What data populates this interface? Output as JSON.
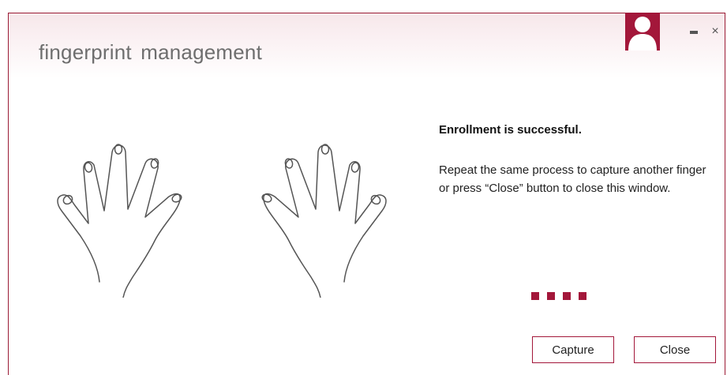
{
  "window": {
    "title": "fingerprint  management",
    "controls": {
      "minimize_glyph": "–",
      "close_glyph": "×"
    }
  },
  "status": {
    "heading": "Enrollment is successful.",
    "message": "Repeat the same process to capture another finger or press “Close” button to close this window."
  },
  "progress": {
    "steps": 4
  },
  "buttons": {
    "capture": "Capture",
    "close": "Close"
  },
  "colors": {
    "accent": "#a3173a",
    "title": "#6e6e6e"
  },
  "icons": {
    "avatar": "user-avatar-icon",
    "hands": "hands-illustration"
  }
}
